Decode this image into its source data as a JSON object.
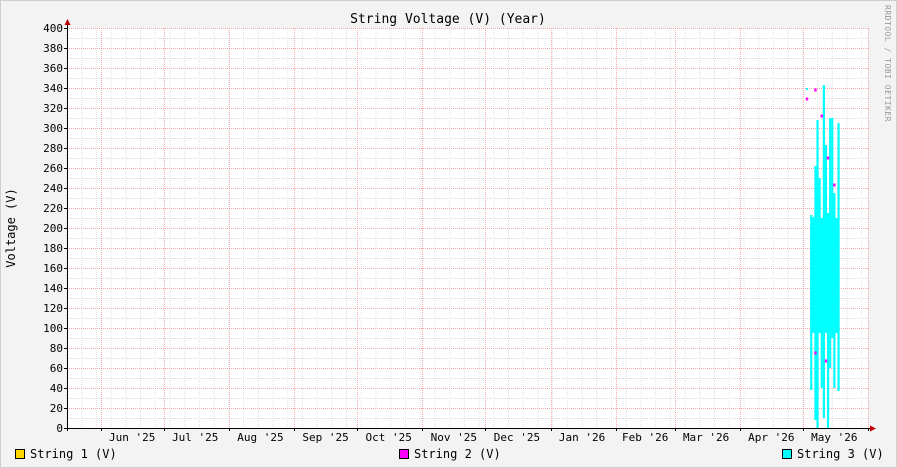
{
  "chart_data": {
    "type": "area",
    "title": "String Voltage (V) (Year)",
    "xlabel": "",
    "ylabel": "Voltage (V)",
    "ylim": [
      0,
      400
    ],
    "yticks": [
      0,
      20,
      40,
      60,
      80,
      100,
      120,
      140,
      160,
      180,
      200,
      220,
      240,
      260,
      280,
      300,
      320,
      340,
      360,
      380,
      400
    ],
    "xlim": [
      "2025-05-16",
      "2026-06-01"
    ],
    "xticks": [
      {
        "label": "Jun '25",
        "date": "2025-06-16"
      },
      {
        "label": "Jul '25",
        "date": "2025-07-16"
      },
      {
        "label": "Aug '25",
        "date": "2025-08-16"
      },
      {
        "label": "Sep '25",
        "date": "2025-09-16"
      },
      {
        "label": "Oct '25",
        "date": "2025-10-16"
      },
      {
        "label": "Nov '25",
        "date": "2025-11-16"
      },
      {
        "label": "Dec '25",
        "date": "2025-12-16"
      },
      {
        "label": "Jan '26",
        "date": "2026-01-16"
      },
      {
        "label": "Feb '26",
        "date": "2026-02-15"
      },
      {
        "label": "Mar '26",
        "date": "2026-03-16"
      },
      {
        "label": "Apr '26",
        "date": "2026-04-16"
      },
      {
        "label": "May '26",
        "date": "2026-05-16"
      }
    ],
    "month_starts": [
      "2025-06-01",
      "2025-07-01",
      "2025-08-01",
      "2025-09-01",
      "2025-10-01",
      "2025-11-01",
      "2025-12-01",
      "2026-01-01",
      "2026-02-01",
      "2026-03-01",
      "2026-04-01",
      "2026-05-01",
      "2026-06-01"
    ],
    "grid": true,
    "legend_position": "bottom",
    "series": [
      {
        "name": "String 1 (V)",
        "color": "#ffd700",
        "points": []
      },
      {
        "name": "String 2 (V)",
        "color": "#ff00ff",
        "points": [
          {
            "x": "2026-05-03",
            "y": 329
          },
          {
            "x": "2026-05-07",
            "y": 338
          },
          {
            "x": "2026-05-10",
            "y": 312
          },
          {
            "x": "2026-05-13",
            "y": 270
          },
          {
            "x": "2026-05-16",
            "y": 243
          },
          {
            "x": "2026-05-07",
            "y": 75
          },
          {
            "x": "2026-05-12",
            "y": 67
          }
        ]
      },
      {
        "name": "String 3 (V)",
        "color": "#00ffff",
        "points": [
          {
            "x": "2026-05-03",
            "y": 339
          },
          {
            "x": "2026-05-05",
            "y": 38
          },
          {
            "x": "2026-05-05",
            "y": 213
          },
          {
            "x": "2026-05-06",
            "y": 210
          },
          {
            "x": "2026-05-07",
            "y": 262
          },
          {
            "x": "2026-05-07",
            "y": 8
          },
          {
            "x": "2026-05-08",
            "y": 308
          },
          {
            "x": "2026-05-08",
            "y": 0
          },
          {
            "x": "2026-05-09",
            "y": 250
          },
          {
            "x": "2026-05-09",
            "y": 100
          },
          {
            "x": "2026-05-10",
            "y": 175
          },
          {
            "x": "2026-05-10",
            "y": 40
          },
          {
            "x": "2026-05-11",
            "y": 343
          },
          {
            "x": "2026-05-11",
            "y": 10
          },
          {
            "x": "2026-05-12",
            "y": 283
          },
          {
            "x": "2026-05-12",
            "y": 190
          },
          {
            "x": "2026-05-13",
            "y": 215
          },
          {
            "x": "2026-05-13",
            "y": 0
          },
          {
            "x": "2026-05-14",
            "y": 310
          },
          {
            "x": "2026-05-14",
            "y": 60
          },
          {
            "x": "2026-05-15",
            "y": 310
          },
          {
            "x": "2026-05-15",
            "y": 90
          },
          {
            "x": "2026-05-16",
            "y": 235
          },
          {
            "x": "2026-05-16",
            "y": 40
          },
          {
            "x": "2026-05-17",
            "y": 180
          },
          {
            "x": "2026-05-17",
            "y": 100
          },
          {
            "x": "2026-05-18",
            "y": 305
          },
          {
            "x": "2026-05-18",
            "y": 37
          }
        ]
      }
    ],
    "watermark": "RRDTOOL / TOBI OETIKER"
  }
}
